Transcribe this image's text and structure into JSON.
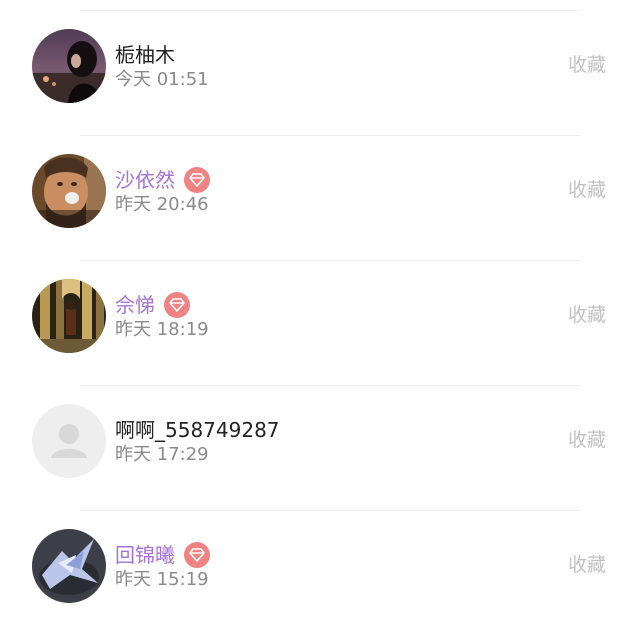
{
  "favorite_label": "收藏",
  "badge_color": "#f08282",
  "vip_name_color": "#a572d6",
  "rows": [
    {
      "name": "栀柚木",
      "time": "今天 01:51",
      "vip": false,
      "avatar": "photo-woman-dark"
    },
    {
      "name": "沙依然",
      "time": "昨天 20:46",
      "vip": true,
      "avatar": "photo-man-drinking"
    },
    {
      "name": "佘悌",
      "time": "昨天 18:19",
      "vip": true,
      "avatar": "photo-cathedral"
    },
    {
      "name": "啊啊_558749287",
      "time": "昨天 17:29",
      "vip": false,
      "avatar": "default-user-icon"
    },
    {
      "name": "回锦曦",
      "time": "昨天 15:19",
      "vip": true,
      "avatar": "photo-fantasy-creature"
    }
  ]
}
